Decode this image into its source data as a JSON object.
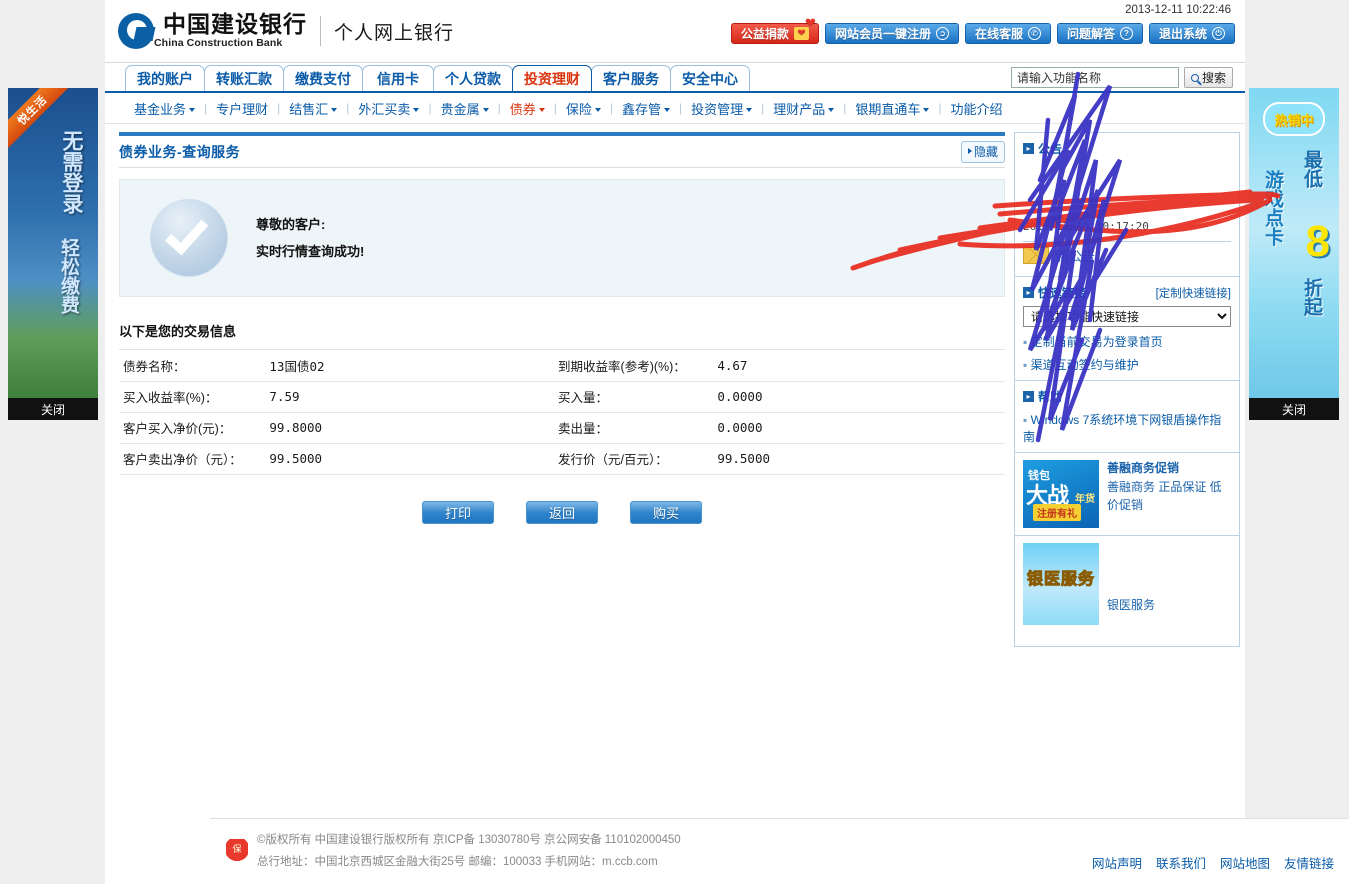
{
  "header": {
    "logo_cn": "中国建设银行",
    "logo_en": "China Construction Bank",
    "logo_sub": "个人网上银行",
    "datetime": "2013-12-11 10:22:46",
    "buttons": [
      {
        "label": "公益捐款",
        "icon": "heart-icon",
        "style": "donate"
      },
      {
        "label": "网站会员一键注册",
        "icon": "cursor-icon",
        "style": "primary"
      },
      {
        "label": "在线客服",
        "icon": "phone-icon",
        "style": "primary"
      },
      {
        "label": "问题解答",
        "icon": "question-icon",
        "style": "primary"
      },
      {
        "label": "退出系统",
        "icon": "power-icon",
        "style": "primary"
      }
    ]
  },
  "nav": {
    "tabs": [
      {
        "label": "我的账户",
        "active": false
      },
      {
        "label": "转账汇款",
        "active": false
      },
      {
        "label": "缴费支付",
        "active": false
      },
      {
        "label": "信用卡",
        "active": false
      },
      {
        "label": "个人贷款",
        "active": false
      },
      {
        "label": "投资理财",
        "active": true
      },
      {
        "label": "客户服务",
        "active": false
      },
      {
        "label": "安全中心",
        "active": false
      }
    ]
  },
  "search": {
    "value": "请输入功能名称",
    "placeholder": "请输入功能名称",
    "button_label": "搜索"
  },
  "subnav": {
    "items": [
      {
        "label": "基金业务",
        "caret": true,
        "on": false
      },
      {
        "label": "专户理财",
        "caret": false,
        "on": false
      },
      {
        "label": "结售汇",
        "caret": true,
        "on": false
      },
      {
        "label": "外汇买卖",
        "caret": true,
        "on": false
      },
      {
        "label": "贵金属",
        "caret": true,
        "on": false
      },
      {
        "label": "债券",
        "caret": true,
        "on": true
      },
      {
        "label": "保险",
        "caret": true,
        "on": false
      },
      {
        "label": "鑫存管",
        "caret": true,
        "on": false
      },
      {
        "label": "投资管理",
        "caret": true,
        "on": false
      },
      {
        "label": "理财产品",
        "caret": true,
        "on": false
      },
      {
        "label": "银期直通车",
        "caret": true,
        "on": false
      },
      {
        "label": "功能介绍",
        "caret": false,
        "on": false
      }
    ]
  },
  "main": {
    "page_title": "债券业务-查询服务",
    "hide_label": "隐藏",
    "success": {
      "line1": "尊敬的客户:",
      "line2": "实时行情查询成功!"
    },
    "info_heading": "以下是您的交易信息",
    "rows": [
      {
        "label_left": "债券名称：",
        "value_left": "13国债02",
        "label_right": "到期收益率(参考)(%)：",
        "value_right": "4.67"
      },
      {
        "label_left": "买入收益率(%)：",
        "value_left": "7.59",
        "label_right": "买入量：",
        "value_right": "0.0000"
      },
      {
        "label_left": "客户买入净价(元)：",
        "value_left": "99.8000",
        "label_right": "卖出量：",
        "value_right": "0.0000"
      },
      {
        "label_left": "客户卖出净价（元）：",
        "value_left": "99.5000",
        "label_right": "发行价（元/百元）：",
        "value_right": "99.5000"
      }
    ],
    "actions": [
      {
        "label": "打印"
      },
      {
        "label": "返回"
      },
      {
        "label": "购买"
      }
    ]
  },
  "sidebar": {
    "notice_section": {
      "title": "公告",
      "date": "2013/12/10 10:17:20",
      "news_label": "新公告"
    },
    "quick_links": {
      "title": "快速链接",
      "custom_label": "[定制快速链接]",
      "select_value": "请选择功能快速链接",
      "options": [
        "请选择功能快速链接"
      ],
      "items": [
        "定制当前交易为登录首页",
        "渠道互动签约与维护"
      ]
    },
    "guide": {
      "title": "帮助",
      "items": [
        "Windows 7系统环境下网银盾操作指南"
      ]
    },
    "ads": [
      {
        "thumb_kind": "promo",
        "thumb_t1": "钱包",
        "thumb_t2": "大战",
        "thumb_t3": "年货",
        "thumb_t4": "注册有礼",
        "heading": "善融商务促销",
        "body": "善融商务 正品保证 低价促销"
      },
      {
        "thumb_kind": "med",
        "thumb_text": "银医服务",
        "heading": "",
        "body": "银医服务"
      }
    ]
  },
  "ads": {
    "left": {
      "ribbon": "悦生活",
      "line1": "无需登录",
      "line2": "轻松缴费",
      "close_label": "关闭"
    },
    "right": {
      "bubble": "热销中",
      "line1": "游戏点卡",
      "line2": "最低",
      "number": "8",
      "line3": "折起",
      "close_label": "关闭"
    }
  },
  "footer": {
    "copyright": "©版权所有 中国建设银行版权所有  京ICP备 13030780号  京公网安备 110102000450",
    "address": "总行地址：中国北京西城区金融大街25号  邮编：100033  手机网站：m.ccb.com",
    "links": [
      "网站声明",
      "联系我们",
      "网站地图",
      "友情链接"
    ]
  },
  "colors": {
    "brand_blue": "#0a5ba8",
    "accent_red": "#d9350f",
    "panel_bg": "#eef5f8"
  }
}
